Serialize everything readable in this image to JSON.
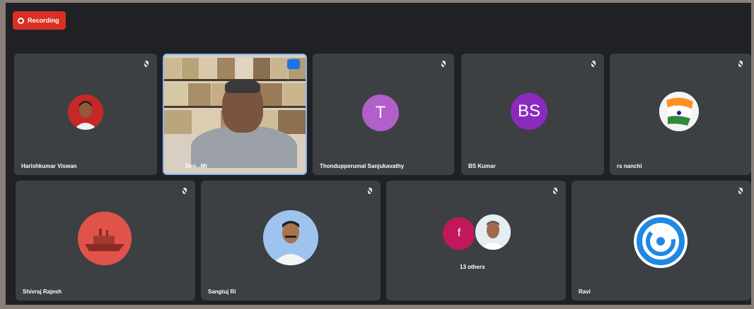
{
  "recording": {
    "label": "Recording"
  },
  "participants": [
    {
      "name": "Harishkumar Viswan",
      "avatar_type": "photo"
    },
    {
      "name": "Deo...Mi",
      "avatar_type": "video"
    },
    {
      "name": "Thondupperumal Sanjukavathy",
      "avatar_type": "initial",
      "initial": "T",
      "color": "#b15fc9"
    },
    {
      "name": "BS Kumar",
      "avatar_type": "initial",
      "initial": "BS",
      "color": "#8a2bbd"
    },
    {
      "name": "rs nanchi",
      "avatar_type": "photo"
    },
    {
      "name": "Shivraj Rajesh",
      "avatar_type": "photo"
    },
    {
      "name": "Sangtuj Ri",
      "avatar_type": "photo"
    },
    {
      "name": "13 others",
      "avatar_type": "group",
      "initial": "f",
      "color": "#c2185b"
    },
    {
      "name": "Ravi",
      "avatar_type": "logo"
    }
  ],
  "icons": {
    "mic_off": "mic-off-icon",
    "record": "record-icon"
  },
  "colors": {
    "background": "#202124",
    "tile": "#3c4043",
    "record": "#d93025",
    "active_border": "#8ab4f8"
  }
}
